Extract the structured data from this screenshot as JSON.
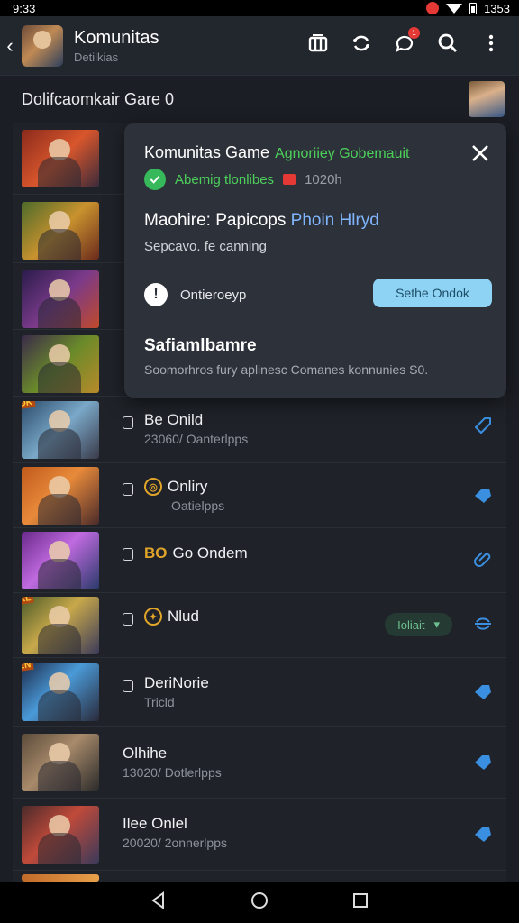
{
  "status_bar": {
    "time_left": "9:33",
    "time_right": "1353"
  },
  "app_bar": {
    "title": "Komunitas",
    "subtitle": "Detilkias",
    "actions": [
      "library-icon",
      "refresh-icon",
      "chat-icon",
      "search-icon",
      "more-vert-icon"
    ],
    "chat_badge": "1"
  },
  "section": {
    "title": "Dolifcaomkair Gare 0"
  },
  "popup": {
    "title": "Komunitas Game",
    "title_accent": "Agnoriiey Gobemauit",
    "status_text": "Abemig tlonlibes",
    "status_count": "1020h",
    "heading_prefix": "Maohire: Papicops",
    "heading_highlight": "Phoin Hlryd",
    "description": "Sepcavo. fe canning",
    "info_label": "Ontieroeyp",
    "info_symbol": "!",
    "button_label": "Sethe Ondok",
    "section_title": "Safiamlbamre",
    "section_desc": "Soomorhros fury aplinesc Comanes konnunies S0."
  },
  "rows": [
    {
      "title": "",
      "sub": "",
      "icon": ""
    },
    {
      "title": "",
      "sub": "",
      "icon": ""
    },
    {
      "title": "",
      "sub": "",
      "icon": ""
    },
    {
      "title": "",
      "sub": "",
      "icon": ""
    },
    {
      "title": "Be Onild",
      "sub": "23060/  Oanterlpps",
      "icon": "tag-outline-icon",
      "tag": "OK"
    },
    {
      "title": "Onliry",
      "sub": "Oatielpps",
      "icon": "tag-filled-icon"
    },
    {
      "title": "Go Ondem",
      "sub": "",
      "icon": "attach-icon",
      "prefix": "BO"
    },
    {
      "title": "Nlud",
      "sub": "",
      "icon": "sync-icon",
      "pill": "Ioliait",
      "tag": "KL"
    },
    {
      "title": "DeriNorie",
      "sub": "Tricld",
      "icon": "tag-filled-icon",
      "tag": "ZN"
    },
    {
      "title": "Olhihe",
      "sub": "13020/  Dotlerlpps",
      "icon": "tag-filled-icon"
    },
    {
      "title": "Ilee Onlel",
      "sub": "20020/  2onnerlpps",
      "icon": "tag-filled-icon"
    }
  ],
  "colors": {
    "accent_green": "#4cd05a",
    "accent_blue": "#8fd3f4",
    "icon_blue": "#3a8fe0"
  }
}
